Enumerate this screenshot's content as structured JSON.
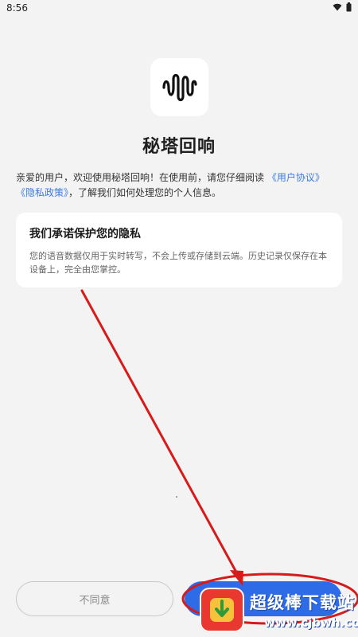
{
  "status": {
    "time": "8:56"
  },
  "app": {
    "title": "秘塔回响"
  },
  "intro": {
    "text_before": "亲爱的用户，欢迎使用秘塔回响！在使用前，请您仔细阅读",
    "link_agreement": "《用户协议》",
    "link_privacy": "《隐私政策》",
    "text_after": "，了解我们如何处理您的个人信息。"
  },
  "privacy_card": {
    "title": "我们承诺保护您的隐私",
    "body": "您的语音数据仅用于实时转写，不会上传或存储到云端。历史记录仅保存在本设备上，完全由您掌控。"
  },
  "buttons": {
    "disagree": "不同意"
  },
  "watermark": {
    "text": "超级棒下载站",
    "url": "www.cjbwh.com"
  },
  "colors": {
    "accent": "#2e6be6",
    "link": "#3b7be0",
    "annotation": "#d71a1a",
    "background": "#f3f3f3"
  }
}
